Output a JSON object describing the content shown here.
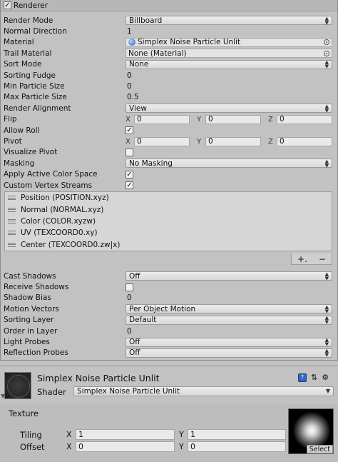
{
  "renderer": {
    "header_label": "Renderer",
    "header_checked": "✓",
    "rows": [
      {
        "label": "Render Mode",
        "value": "Billboard"
      },
      {
        "label": "Normal Direction",
        "value": "1"
      },
      {
        "label": "Material",
        "value": "Simplex Noise Particle Unlit"
      },
      {
        "label": "Trail Material",
        "value": "None (Material)"
      },
      {
        "label": "Sort Mode",
        "value": "None"
      },
      {
        "label": "Sorting Fudge",
        "value": "0"
      },
      {
        "label": "Min Particle Size",
        "value": "0"
      },
      {
        "label": "Max Particle Size",
        "value": "0.5"
      },
      {
        "label": "Render Alignment",
        "value": "View"
      },
      {
        "label": "Flip",
        "x": "0",
        "y": "0",
        "z": "0"
      },
      {
        "label": "Allow Roll",
        "checked": "✓"
      },
      {
        "label": "Pivot",
        "x": "0",
        "y": "0",
        "z": "0"
      },
      {
        "label": "Visualize Pivot",
        "checked": ""
      },
      {
        "label": "Masking",
        "value": "No Masking"
      },
      {
        "label": "Apply Active Color Space",
        "checked": "✓"
      },
      {
        "label": "Custom Vertex Streams",
        "checked": "✓"
      }
    ],
    "axis_labels": {
      "x": "X",
      "y": "Y",
      "z": "Z"
    },
    "vertex_streams": [
      "Position (POSITION.xyz)",
      "Normal (NORMAL.xyz)",
      "Color (COLOR.xyzw)",
      "UV (TEXCOORD0.xy)",
      "Center (TEXCOORD0.zw|x)"
    ],
    "plus_label": "+.",
    "minus_label": "−",
    "rows2": [
      {
        "label": "Cast Shadows",
        "value": "Off"
      },
      {
        "label": "Receive Shadows",
        "checked": ""
      },
      {
        "label": "Shadow Bias",
        "value": "0"
      },
      {
        "label": "Motion Vectors",
        "value": "Per Object Motion"
      },
      {
        "label": "Sorting Layer",
        "value": "Default"
      },
      {
        "label": "Order in Layer",
        "value": "0"
      },
      {
        "label": "Light Probes",
        "value": "Off"
      },
      {
        "label": "Reflection Probes",
        "value": "Off"
      }
    ]
  },
  "material": {
    "title": "Simplex Noise Particle Unlit",
    "book_glyph": "?",
    "sliders_glyph": "⇅",
    "gear_glyph": "⚙",
    "shader_label": "Shader",
    "shader_value": "Simplex Noise Particle Unlit",
    "texture_label": "Texture",
    "tiling_label": "Tiling",
    "offset_label": "Offset",
    "tiling_x": "1",
    "tiling_y": "1",
    "offset_x": "0",
    "offset_y": "0",
    "select_label": "Select",
    "axis_x": "X",
    "axis_y": "Y"
  },
  "colors": {
    "panel_bg": "#c2c2c2",
    "field_bg": "#e9e9e9",
    "accent_blue": "#2c67c7"
  }
}
